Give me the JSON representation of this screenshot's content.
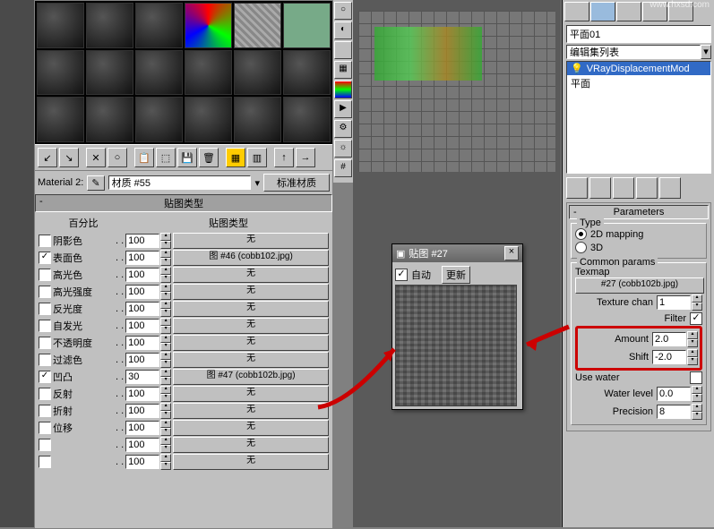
{
  "material_editor": {
    "name_label": "Material 2:",
    "name_value": "材质 #55",
    "type_btn": "标准材质",
    "dropdown_icon": "▾",
    "rollout_title": "贴图类型",
    "col_percent": "百分比",
    "col_type": "贴图类型",
    "none": "无",
    "rows": [
      {
        "chk": false,
        "label": "阴影色",
        "val": "100",
        "slot": "无"
      },
      {
        "chk": true,
        "label": "表面色",
        "val": "100",
        "slot": "图 #46 (cobb102.jpg)"
      },
      {
        "chk": false,
        "label": "高光色",
        "val": "100",
        "slot": "无"
      },
      {
        "chk": false,
        "label": "高光强度",
        "val": "100",
        "slot": "无"
      },
      {
        "chk": false,
        "label": "反光度",
        "val": "100",
        "slot": "无"
      },
      {
        "chk": false,
        "label": "自发光",
        "val": "100",
        "slot": "无"
      },
      {
        "chk": false,
        "label": "不透明度",
        "val": "100",
        "slot": "无"
      },
      {
        "chk": false,
        "label": "过滤色",
        "val": "100",
        "slot": "无"
      },
      {
        "chk": true,
        "label": "凹凸",
        "val": "30",
        "slot": "图 #47 (cobb102b.jpg)"
      },
      {
        "chk": false,
        "label": "反射",
        "val": "100",
        "slot": "无"
      },
      {
        "chk": false,
        "label": "折射",
        "val": "100",
        "slot": "无"
      },
      {
        "chk": false,
        "label": "位移",
        "val": "100",
        "slot": "无"
      },
      {
        "chk": false,
        "label": "",
        "val": "100",
        "slot": "无"
      },
      {
        "chk": false,
        "label": "",
        "val": "100",
        "slot": "无"
      }
    ]
  },
  "floating": {
    "title": "贴图 #27",
    "auto": "自动",
    "refresh": "更新",
    "close": "×"
  },
  "right": {
    "obj_name": "平面01",
    "mod_list_label": "编辑集列表",
    "stack": [
      {
        "icon": "💡",
        "label": "VRayDisplacementMod",
        "sel": true
      },
      {
        "icon": "",
        "label": "平面",
        "sel": false
      }
    ],
    "params_title": "Parameters",
    "type_group": "Type",
    "type_2d": "2D mapping",
    "type_3d": "3D",
    "common_group": "Common params",
    "texmap": "Texmap",
    "texmap_slot": "#27 (cobb102b.jpg)",
    "texchan": "Texture chan",
    "texchan_val": "1",
    "filter": "Filter",
    "amount": "Amount",
    "amount_val": "2.0",
    "shift": "Shift",
    "shift_val": "-2.0",
    "use_water": "Use water",
    "water_level": "Water level",
    "water_val": "0.0",
    "precision": "Precision",
    "precision_val": "8"
  },
  "watermark_url": "www.hxsd.com"
}
